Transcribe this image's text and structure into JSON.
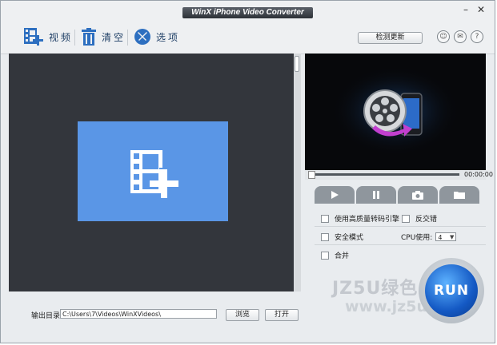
{
  "window": {
    "title": "WinX iPhone Video Converter"
  },
  "toolbar": {
    "video_label": "视频",
    "clear_label": "清空",
    "options_label": "选项",
    "check_update_label": "检测更新"
  },
  "player": {
    "time": "00:00:00"
  },
  "options": {
    "hq_engine": "使用高质量转码引擎",
    "deinterlace": "反交错",
    "safe_mode": "安全模式",
    "cpu_label": "CPU使用:",
    "cpu_value": "4",
    "merge": "合并"
  },
  "output": {
    "label": "输出目录:",
    "path": "C:\\Users\\7\\Videos\\WinXVideos\\",
    "browse_label": "浏览",
    "open_label": "打开"
  },
  "run": {
    "label": "RUN"
  },
  "watermark": {
    "line1": "JZ5U绿色",
    "line2": "www.jz5u.com"
  }
}
